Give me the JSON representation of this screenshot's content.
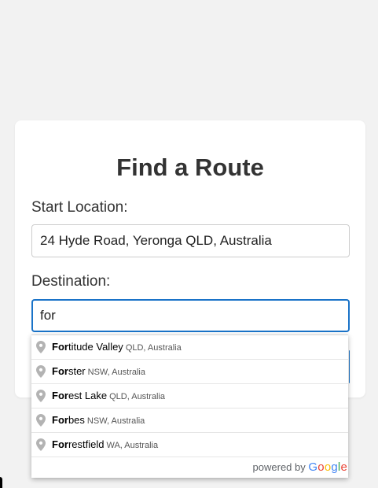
{
  "form": {
    "title": "Find a Route",
    "start_label": "Start Location:",
    "start_value": "24 Hyde Road, Yeronga QLD, Australia",
    "destination_label": "Destination:",
    "destination_value": "for"
  },
  "suggestions": [
    {
      "match": "For",
      "rest": "titude Valley",
      "secondary": "QLD, Australia"
    },
    {
      "match": "For",
      "rest": "ster",
      "secondary": "NSW, Australia"
    },
    {
      "match": "For",
      "rest": "est Lake",
      "secondary": "QLD, Australia"
    },
    {
      "match": "For",
      "rest": "bes",
      "secondary": "NSW, Australia"
    },
    {
      "match": "For",
      "rest": "restfield",
      "secondary": "WA, Australia"
    }
  ],
  "attribution": {
    "prefix": "powered by",
    "brand_letters": [
      "G",
      "o",
      "o",
      "g",
      "l",
      "e"
    ]
  },
  "icons": {
    "suggestion_icon": "map-pin-icon"
  },
  "colors": {
    "focus_border": "#1a73c8",
    "background": "#f2f2f2"
  }
}
